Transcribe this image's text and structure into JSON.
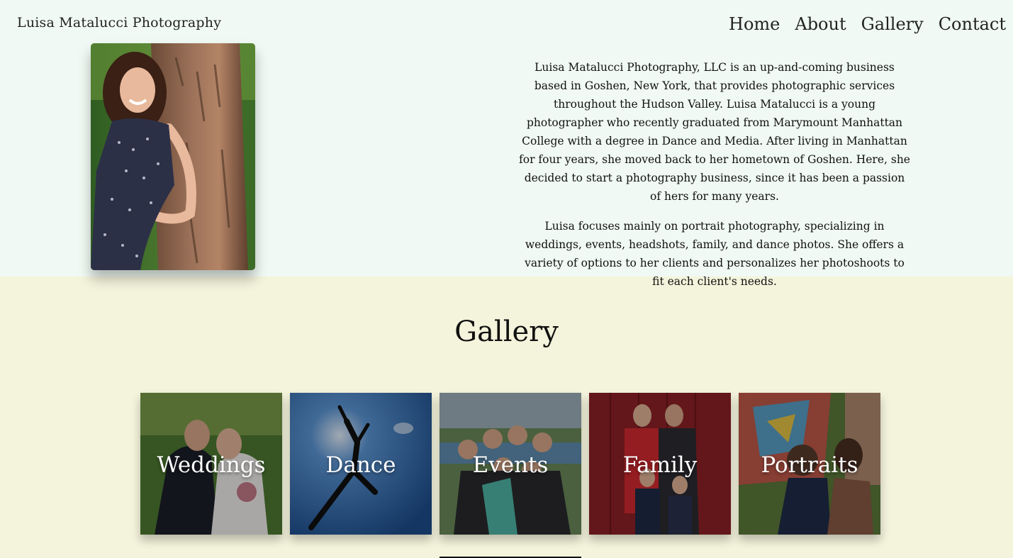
{
  "header": {
    "brand": "Luisa Matalucci Photography",
    "nav": [
      "Home",
      "About",
      "Gallery",
      "Contact"
    ]
  },
  "about": {
    "paragraphs": [
      "Luisa Matalucci Photography, LLC is an up-and-coming business based in Goshen, New York, that provides photographic services throughout the Hudson Valley. Luisa Matalucci is a young photographer who recently graduated from Marymount Manhattan College with a degree in Dance and Media. After living in Manhattan for four years, she moved back to her hometown of Goshen. Here, she decided to start a photography business, since it has been a passion of hers for many years.",
      "Luisa focuses mainly on portrait photography, specializing in weddings, events, headshots, family, and dance photos. She offers a variety of options to her clients and personalizes her photoshoots to fit each client's needs."
    ]
  },
  "gallery": {
    "title": "Gallery",
    "tiles": [
      {
        "label": "Weddings"
      },
      {
        "label": "Dance"
      },
      {
        "label": "Events"
      },
      {
        "label": "Family"
      },
      {
        "label": "Portraits"
      }
    ]
  },
  "colors": {
    "about_bg": "#f0f9f3",
    "gallery_bg": "#f4f4dc",
    "text": "#111111"
  }
}
